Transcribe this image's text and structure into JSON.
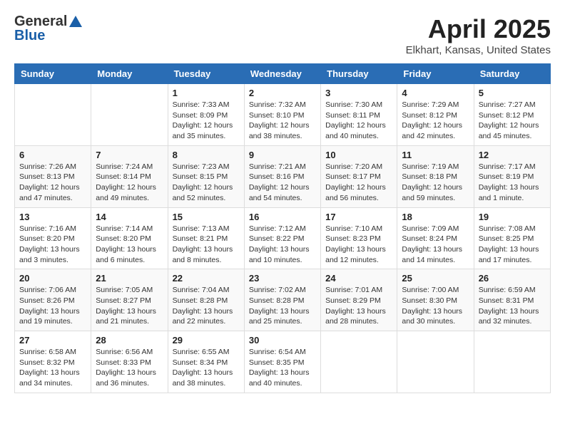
{
  "logo": {
    "general": "General",
    "blue": "Blue"
  },
  "title": "April 2025",
  "subtitle": "Elkhart, Kansas, United States",
  "weekdays": [
    "Sunday",
    "Monday",
    "Tuesday",
    "Wednesday",
    "Thursday",
    "Friday",
    "Saturday"
  ],
  "weeks": [
    [
      {
        "day": "",
        "info": ""
      },
      {
        "day": "",
        "info": ""
      },
      {
        "day": "1",
        "info": "Sunrise: 7:33 AM\nSunset: 8:09 PM\nDaylight: 12 hours and 35 minutes."
      },
      {
        "day": "2",
        "info": "Sunrise: 7:32 AM\nSunset: 8:10 PM\nDaylight: 12 hours and 38 minutes."
      },
      {
        "day": "3",
        "info": "Sunrise: 7:30 AM\nSunset: 8:11 PM\nDaylight: 12 hours and 40 minutes."
      },
      {
        "day": "4",
        "info": "Sunrise: 7:29 AM\nSunset: 8:12 PM\nDaylight: 12 hours and 42 minutes."
      },
      {
        "day": "5",
        "info": "Sunrise: 7:27 AM\nSunset: 8:12 PM\nDaylight: 12 hours and 45 minutes."
      }
    ],
    [
      {
        "day": "6",
        "info": "Sunrise: 7:26 AM\nSunset: 8:13 PM\nDaylight: 12 hours and 47 minutes."
      },
      {
        "day": "7",
        "info": "Sunrise: 7:24 AM\nSunset: 8:14 PM\nDaylight: 12 hours and 49 minutes."
      },
      {
        "day": "8",
        "info": "Sunrise: 7:23 AM\nSunset: 8:15 PM\nDaylight: 12 hours and 52 minutes."
      },
      {
        "day": "9",
        "info": "Sunrise: 7:21 AM\nSunset: 8:16 PM\nDaylight: 12 hours and 54 minutes."
      },
      {
        "day": "10",
        "info": "Sunrise: 7:20 AM\nSunset: 8:17 PM\nDaylight: 12 hours and 56 minutes."
      },
      {
        "day": "11",
        "info": "Sunrise: 7:19 AM\nSunset: 8:18 PM\nDaylight: 12 hours and 59 minutes."
      },
      {
        "day": "12",
        "info": "Sunrise: 7:17 AM\nSunset: 8:19 PM\nDaylight: 13 hours and 1 minute."
      }
    ],
    [
      {
        "day": "13",
        "info": "Sunrise: 7:16 AM\nSunset: 8:20 PM\nDaylight: 13 hours and 3 minutes."
      },
      {
        "day": "14",
        "info": "Sunrise: 7:14 AM\nSunset: 8:20 PM\nDaylight: 13 hours and 6 minutes."
      },
      {
        "day": "15",
        "info": "Sunrise: 7:13 AM\nSunset: 8:21 PM\nDaylight: 13 hours and 8 minutes."
      },
      {
        "day": "16",
        "info": "Sunrise: 7:12 AM\nSunset: 8:22 PM\nDaylight: 13 hours and 10 minutes."
      },
      {
        "day": "17",
        "info": "Sunrise: 7:10 AM\nSunset: 8:23 PM\nDaylight: 13 hours and 12 minutes."
      },
      {
        "day": "18",
        "info": "Sunrise: 7:09 AM\nSunset: 8:24 PM\nDaylight: 13 hours and 14 minutes."
      },
      {
        "day": "19",
        "info": "Sunrise: 7:08 AM\nSunset: 8:25 PM\nDaylight: 13 hours and 17 minutes."
      }
    ],
    [
      {
        "day": "20",
        "info": "Sunrise: 7:06 AM\nSunset: 8:26 PM\nDaylight: 13 hours and 19 minutes."
      },
      {
        "day": "21",
        "info": "Sunrise: 7:05 AM\nSunset: 8:27 PM\nDaylight: 13 hours and 21 minutes."
      },
      {
        "day": "22",
        "info": "Sunrise: 7:04 AM\nSunset: 8:28 PM\nDaylight: 13 hours and 22 minutes."
      },
      {
        "day": "23",
        "info": "Sunrise: 7:02 AM\nSunset: 8:28 PM\nDaylight: 13 hours and 25 minutes."
      },
      {
        "day": "24",
        "info": "Sunrise: 7:01 AM\nSunset: 8:29 PM\nDaylight: 13 hours and 28 minutes."
      },
      {
        "day": "25",
        "info": "Sunrise: 7:00 AM\nSunset: 8:30 PM\nDaylight: 13 hours and 30 minutes."
      },
      {
        "day": "26",
        "info": "Sunrise: 6:59 AM\nSunset: 8:31 PM\nDaylight: 13 hours and 32 minutes."
      }
    ],
    [
      {
        "day": "27",
        "info": "Sunrise: 6:58 AM\nSunset: 8:32 PM\nDaylight: 13 hours and 34 minutes."
      },
      {
        "day": "28",
        "info": "Sunrise: 6:56 AM\nSunset: 8:33 PM\nDaylight: 13 hours and 36 minutes."
      },
      {
        "day": "29",
        "info": "Sunrise: 6:55 AM\nSunset: 8:34 PM\nDaylight: 13 hours and 38 minutes."
      },
      {
        "day": "30",
        "info": "Sunrise: 6:54 AM\nSunset: 8:35 PM\nDaylight: 13 hours and 40 minutes."
      },
      {
        "day": "",
        "info": ""
      },
      {
        "day": "",
        "info": ""
      },
      {
        "day": "",
        "info": ""
      }
    ]
  ]
}
